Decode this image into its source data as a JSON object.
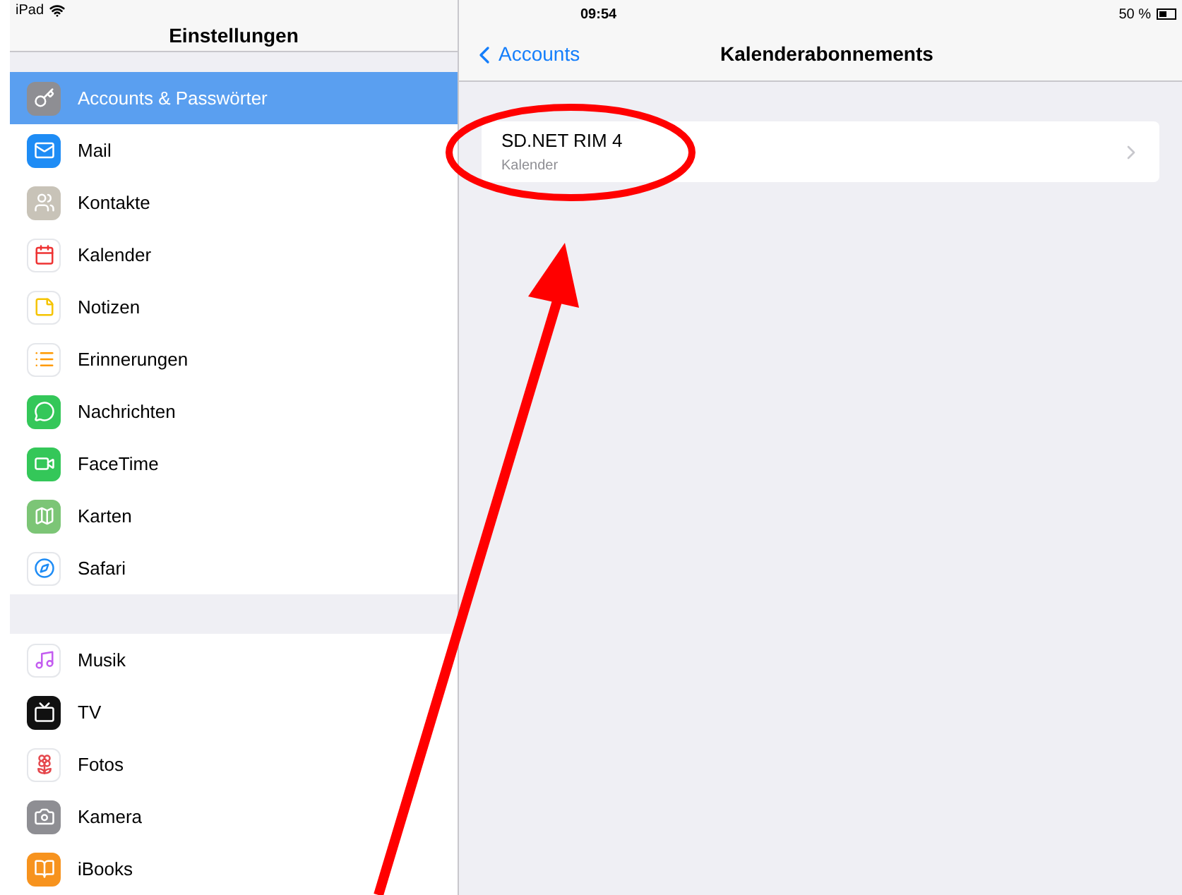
{
  "status_bar": {
    "device": "iPad",
    "time": "09:54",
    "battery": "50 %"
  },
  "sidebar": {
    "title": "Einstellungen",
    "groups": [
      {
        "items": [
          {
            "label": "Accounts & Passwörter",
            "selected": true
          },
          {
            "label": "Mail",
            "selected": false
          },
          {
            "label": "Kontakte",
            "selected": false
          },
          {
            "label": "Kalender",
            "selected": false
          },
          {
            "label": "Notizen",
            "selected": false
          },
          {
            "label": "Erinnerungen",
            "selected": false
          },
          {
            "label": "Nachrichten",
            "selected": false
          },
          {
            "label": "FaceTime",
            "selected": false
          },
          {
            "label": "Karten",
            "selected": false
          },
          {
            "label": "Safari",
            "selected": false
          }
        ]
      },
      {
        "items": [
          {
            "label": "Musik",
            "selected": false
          },
          {
            "label": "TV",
            "selected": false
          },
          {
            "label": "Fotos",
            "selected": false
          },
          {
            "label": "Kamera",
            "selected": false
          },
          {
            "label": "iBooks",
            "selected": false
          }
        ]
      }
    ]
  },
  "detail": {
    "back": "Accounts",
    "title": "Kalenderabonnements",
    "rows": [
      {
        "title": "SD.NET RIM 4",
        "subtitle": "Kalender"
      }
    ]
  }
}
